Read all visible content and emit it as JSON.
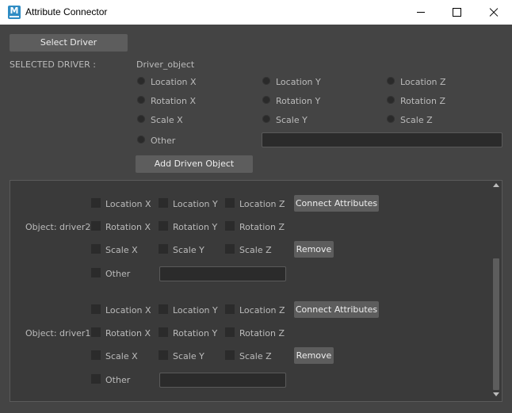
{
  "window": {
    "title": "Attribute Connector",
    "icon": "maya-app-icon",
    "icon_letter": "M"
  },
  "driver": {
    "select_button": "Select Driver",
    "selected_label": "SELECTED DRIVER :",
    "selected_value": "Driver_object",
    "attributes": [
      "Location X",
      "Location Y",
      "Location Z",
      "Rotation X",
      "Rotation Y",
      "Rotation Z",
      "Scale X",
      "Scale Y",
      "Scale Z"
    ],
    "other_label": "Other",
    "other_value": "",
    "add_driven_button": "Add Driven Object"
  },
  "driven_objects": [
    {
      "label": "Object: driver2",
      "attributes": [
        "Location X",
        "Location Y",
        "Location Z",
        "Rotation X",
        "Rotation Y",
        "Rotation Z",
        "Scale X",
        "Scale Y",
        "Scale Z"
      ],
      "connect_button": "Connect Attributes",
      "remove_button": "Remove",
      "other_label": "Other",
      "other_value": ""
    },
    {
      "label": "Object: driver1",
      "attributes": [
        "Location X",
        "Location Y",
        "Location Z",
        "Rotation X",
        "Rotation Y",
        "Rotation Z",
        "Scale X",
        "Scale Y",
        "Scale Z"
      ],
      "connect_button": "Connect Attributes",
      "remove_button": "Remove",
      "other_label": "Other",
      "other_value": ""
    }
  ],
  "colors": {
    "background": "#444444",
    "panel": "#3a3a3a",
    "button": "#5d5d5d",
    "text": "#bbbbbb",
    "titlebar": "#ffffff",
    "app_icon": "#2f8cc4"
  }
}
